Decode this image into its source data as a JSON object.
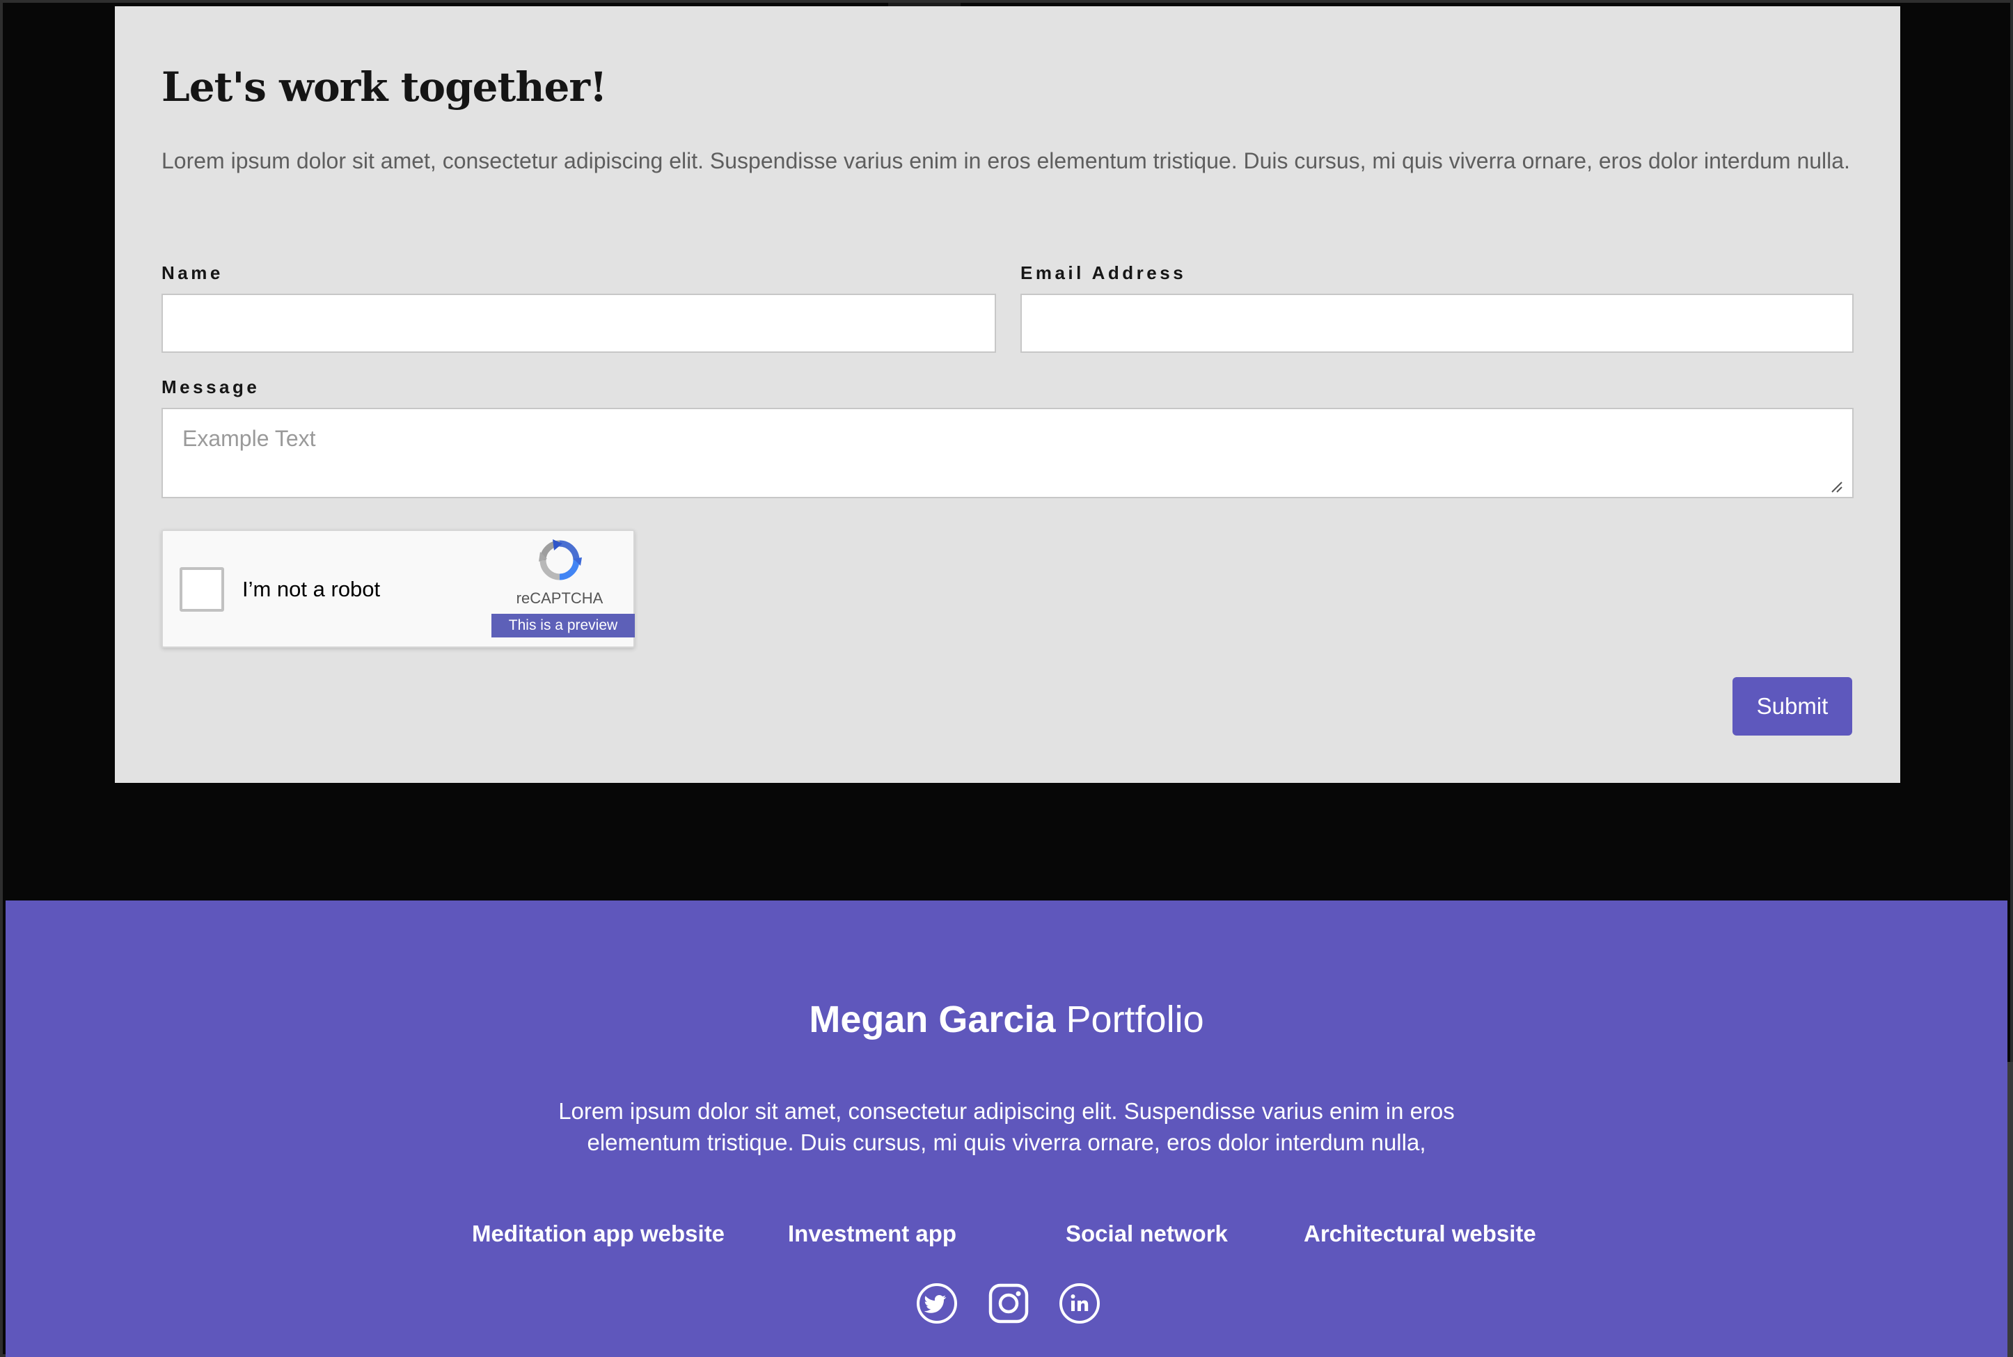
{
  "contact": {
    "title": "Let's work together!",
    "intro": "Lorem ipsum dolor sit amet, consectetur adipiscing elit. Suspendisse varius enim in eros elementum tristique. Duis cursus, mi quis viverra ornare, eros dolor interdum nulla.",
    "name_label": "Name",
    "name_value": "",
    "email_label": "Email Address",
    "email_value": "",
    "message_label": "Message",
    "message_placeholder": "Example Text",
    "captcha": {
      "label": "I’m not a robot",
      "brand": "reCAPTCHA",
      "preview": "This is a preview",
      "checked": false
    },
    "submit_label": "Submit"
  },
  "footer": {
    "brand_name": "Megan Garcia",
    "brand_suffix": "Portfolio",
    "text": "Lorem ipsum dolor sit amet, consectetur adipiscing elit. Suspendisse varius enim in eros elementum tristique. Duis cursus, mi quis viverra ornare, eros dolor interdum nulla,",
    "links": [
      {
        "label": "Meditation app website"
      },
      {
        "label": "Investment app"
      },
      {
        "label": "Social network"
      },
      {
        "label": "Architectural website"
      }
    ],
    "social": [
      {
        "icon": "twitter-icon"
      },
      {
        "icon": "instagram-icon"
      },
      {
        "icon": "linkedin-icon"
      }
    ]
  },
  "colors": {
    "page_bg": "#070707",
    "card_bg": "#e2e2e2",
    "accent": "#5e58bd",
    "footer_bg": "#5f57bc",
    "captcha_preview": "#5d60b8"
  }
}
